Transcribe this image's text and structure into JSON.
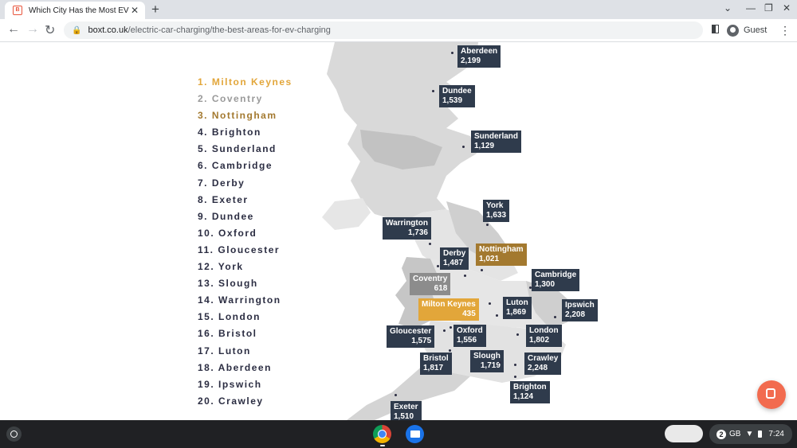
{
  "browser": {
    "tab_title": "Which City Has the Most EV Cha",
    "tab_close": "✕",
    "new_tab": "+",
    "url_host": "boxt.co.uk",
    "url_path": "/electric-car-charging/the-best-areas-for-ev-charging",
    "profile_label": "Guest",
    "menu": "⋮"
  },
  "ranking": [
    {
      "text": "1. Milton Keynes",
      "tier": "gold"
    },
    {
      "text": "2. Coventry",
      "tier": "silver"
    },
    {
      "text": "3. Nottingham",
      "tier": "bronze"
    },
    {
      "text": "4. Brighton",
      "tier": ""
    },
    {
      "text": "5. Sunderland",
      "tier": ""
    },
    {
      "text": "6. Cambridge",
      "tier": ""
    },
    {
      "text": "7. Derby",
      "tier": ""
    },
    {
      "text": "8. Exeter",
      "tier": ""
    },
    {
      "text": "9. Dundee",
      "tier": ""
    },
    {
      "text": "10. Oxford",
      "tier": ""
    },
    {
      "text": "11. Gloucester",
      "tier": ""
    },
    {
      "text": "12. York",
      "tier": ""
    },
    {
      "text": "13. Slough",
      "tier": ""
    },
    {
      "text": "14. Warrington",
      "tier": ""
    },
    {
      "text": "15. London",
      "tier": ""
    },
    {
      "text": "16. Bristol",
      "tier": ""
    },
    {
      "text": "17. Luton",
      "tier": ""
    },
    {
      "text": "18. Aberdeen",
      "tier": ""
    },
    {
      "text": "19. Ipswich",
      "tier": ""
    },
    {
      "text": "20. Crawley",
      "tier": ""
    }
  ],
  "map_labels": [
    {
      "city": "Aberdeen",
      "value": "2,199",
      "tier": ""
    },
    {
      "city": "Dundee",
      "value": "1,539",
      "tier": ""
    },
    {
      "city": "Sunderland",
      "value": "1,129",
      "tier": ""
    },
    {
      "city": "York",
      "value": "1,633",
      "tier": ""
    },
    {
      "city": "Warrington",
      "value": "1,736",
      "tier": ""
    },
    {
      "city": "Derby",
      "value": "1,487",
      "tier": ""
    },
    {
      "city": "Nottingham",
      "value": "1,021",
      "tier": "bronze"
    },
    {
      "city": "Coventry",
      "value": "618",
      "tier": "silver"
    },
    {
      "city": "Cambridge",
      "value": "1,300",
      "tier": ""
    },
    {
      "city": "Milton Keynes",
      "value": "435",
      "tier": "gold"
    },
    {
      "city": "Luton",
      "value": "1,869",
      "tier": ""
    },
    {
      "city": "Ipswich",
      "value": "2,208",
      "tier": ""
    },
    {
      "city": "Gloucester",
      "value": "1,575",
      "tier": ""
    },
    {
      "city": "Oxford",
      "value": "1,556",
      "tier": ""
    },
    {
      "city": "London",
      "value": "1,802",
      "tier": ""
    },
    {
      "city": "Bristol",
      "value": "1,817",
      "tier": ""
    },
    {
      "city": "Slough",
      "value": "1,719",
      "tier": ""
    },
    {
      "city": "Crawley",
      "value": "2,248",
      "tier": ""
    },
    {
      "city": "Brighton",
      "value": "1,124",
      "tier": ""
    },
    {
      "city": "Exeter",
      "value": "1,510",
      "tier": ""
    }
  ],
  "colors": {
    "gold": "#e2a63a",
    "silver": "#8c8c8c",
    "bronze": "#a3792f",
    "label_bg": "#2f3b4c"
  },
  "shelf": {
    "notification_count": "2",
    "network": "GB",
    "time": "7:24"
  }
}
